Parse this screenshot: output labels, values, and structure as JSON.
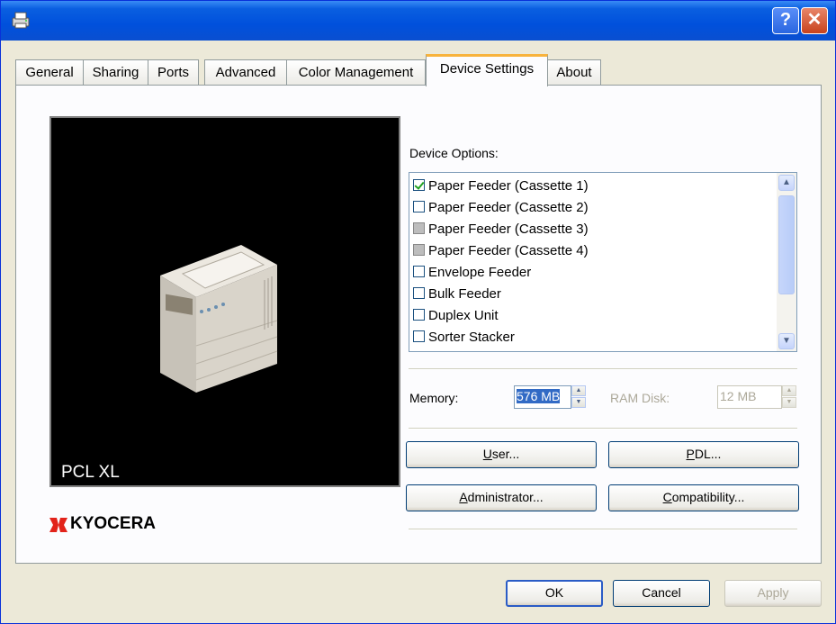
{
  "window": {
    "help_label": "?",
    "close_label": "✕"
  },
  "tabs": [
    {
      "label": "General"
    },
    {
      "label": "Sharing"
    },
    {
      "label": "Ports"
    },
    {
      "label": "Advanced"
    },
    {
      "label": "Color Management"
    },
    {
      "label": "Device Settings",
      "active": true
    },
    {
      "label": "About"
    }
  ],
  "preview": {
    "pdl_text": "PCL XL"
  },
  "brand": {
    "logo_text": "KYOCERA",
    "logo_color": "#e2231a"
  },
  "device_options": {
    "label": "Device Options:",
    "items": [
      {
        "label": "Paper Feeder (Cassette 1)",
        "state": "checked"
      },
      {
        "label": "Paper Feeder (Cassette 2)",
        "state": "unchecked"
      },
      {
        "label": "Paper Feeder (Cassette 3)",
        "state": "indeterminate"
      },
      {
        "label": "Paper Feeder (Cassette 4)",
        "state": "indeterminate"
      },
      {
        "label": "Envelope Feeder",
        "state": "unchecked"
      },
      {
        "label": "Bulk Feeder",
        "state": "unchecked"
      },
      {
        "label": "Duplex Unit",
        "state": "unchecked"
      },
      {
        "label": "Sorter Stacker",
        "state": "unchecked"
      }
    ]
  },
  "memory": {
    "label": "Memory:",
    "value": "576 MB"
  },
  "ram_disk": {
    "label": "RAM Disk:",
    "value": "12 MB",
    "enabled": false
  },
  "buttons": {
    "user_pre": "",
    "user_key": "U",
    "user_post": "ser...",
    "pdl_pre": "",
    "pdl_key": "P",
    "pdl_post": "DL...",
    "admin_pre": "",
    "admin_key": "A",
    "admin_post": "dministrator...",
    "compat_pre": "",
    "compat_key": "C",
    "compat_post": "ompatibility..."
  },
  "footer": {
    "ok": "OK",
    "cancel": "Cancel",
    "apply": "Apply"
  },
  "colors": {
    "titlebar": "#0050dc",
    "tab_highlight": "#f8b33c",
    "selection": "#316ac5"
  }
}
